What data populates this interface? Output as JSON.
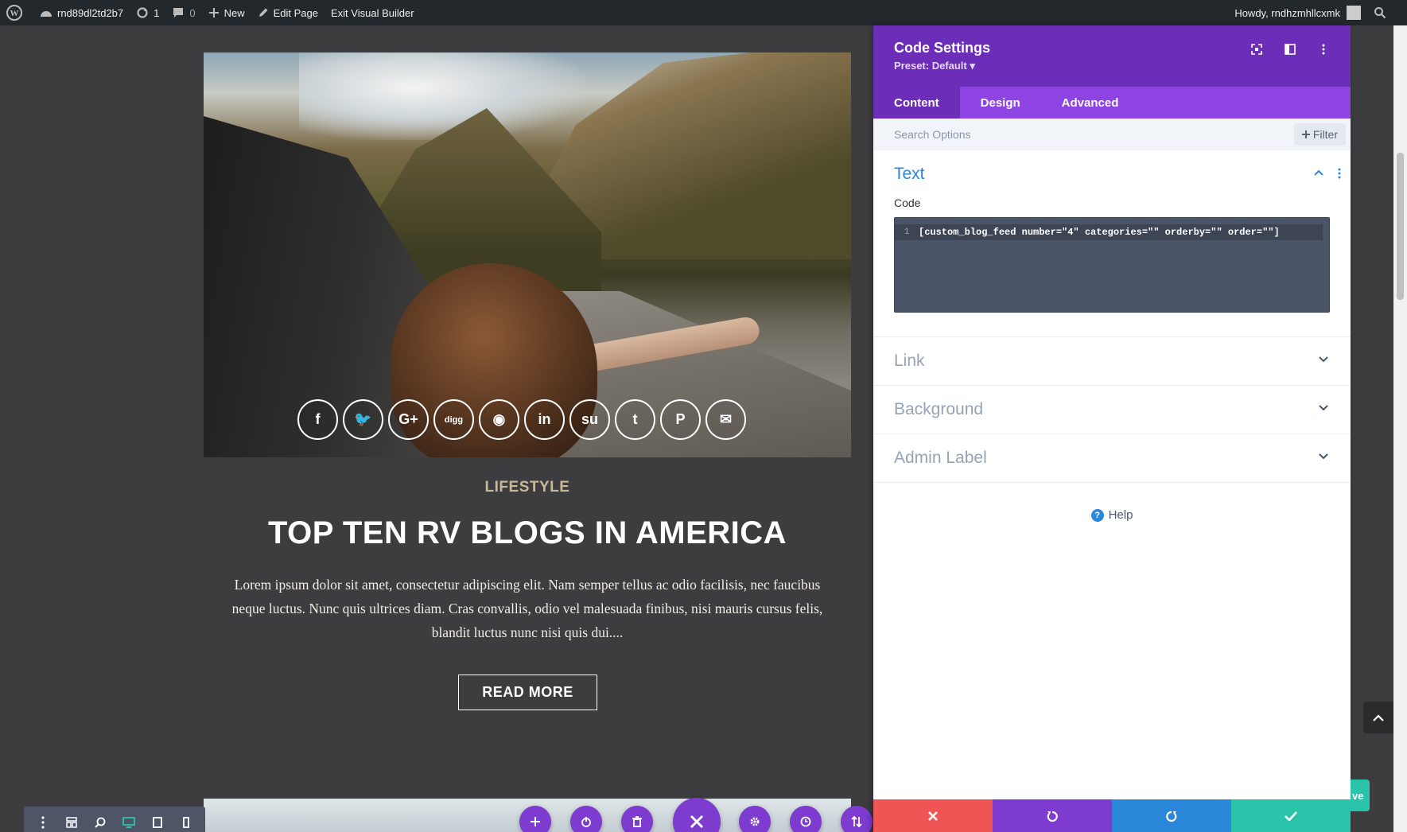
{
  "adminbar": {
    "site_name": "rnd89dl2td2b7",
    "updates_count": "1",
    "comments_count": "0",
    "new_label": "New",
    "edit_page_label": "Edit Page",
    "exit_builder_label": "Exit Visual Builder",
    "howdy_label": "Howdy, rndhzmhllcxmk"
  },
  "post": {
    "category": "LIFESTYLE",
    "title": "TOP TEN RV BLOGS IN AMERICA",
    "excerpt": "Lorem ipsum dolor sit amet, consectetur adipiscing elit. Nam semper tellus ac odio facilisis, nec faucibus neque luctus. Nunc quis ultrices diam. Cras convallis, odio vel malesuada finibus, nisi mauris cursus felis, blandit luctus nunc nisi quis dui....",
    "read_more_label": "READ MORE",
    "social_icons": [
      "facebook-icon",
      "twitter-icon",
      "google-plus-icon",
      "digg-icon",
      "reddit-icon",
      "linkedin-icon",
      "stumbleupon-icon",
      "tumblr-icon",
      "pinterest-icon",
      "email-icon"
    ],
    "social_glyphs": [
      "f",
      "🐦",
      "G+",
      "digg",
      "◉",
      "in",
      "su",
      "t",
      "P",
      "✉"
    ]
  },
  "panel": {
    "title": "Code Settings",
    "preset": "Preset: Default ▾",
    "tabs": [
      {
        "label": "Content",
        "active": true
      },
      {
        "label": "Design",
        "active": false
      },
      {
        "label": "Advanced",
        "active": false
      }
    ],
    "search_placeholder": "Search Options",
    "filter_label": "Filter",
    "sections": {
      "text": {
        "label": "Text",
        "field_label": "Code",
        "line_number": "1",
        "code_value": "[custom_blog_feed number=\"4\" categories=\"\" orderby=\"\" order=\"\"]"
      },
      "link": {
        "label": "Link"
      },
      "background": {
        "label": "Background"
      },
      "admin_label": {
        "label": "Admin Label"
      }
    },
    "help_label": "Help"
  },
  "save_peek_label": "ve",
  "colors": {
    "admin_bar": "#23282d",
    "panel_header": "#6c2eb9",
    "panel_tabs": "#8e44e3",
    "accent_blue": "#2b87da",
    "cancel_red": "#ef5555",
    "save_green": "#29c4a9",
    "module_purple": "#7e3bd0"
  }
}
